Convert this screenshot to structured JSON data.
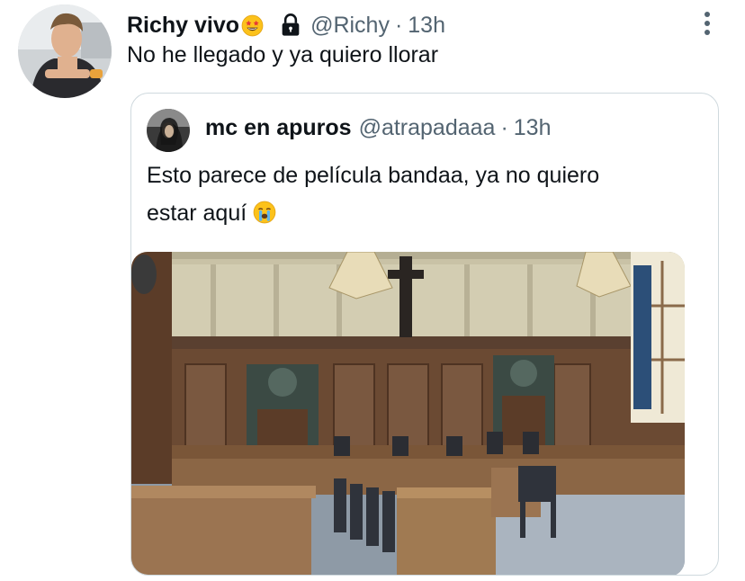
{
  "tweet": {
    "display_name": "Richy vivo",
    "handle": "@Richy",
    "separator": "·",
    "time": "13h",
    "text": "No he llegado y ya quiero llorar",
    "name_emoji": "star-struck-emoji",
    "protected_icon": "lock-icon"
  },
  "quoted_tweet": {
    "display_name": "mc en apuros",
    "handle": "@atrapadaaa",
    "separator": "·",
    "time": "13h",
    "text_line1": "Esto parece de película bandaa, ya no quiero",
    "text_line2": "estar aquí",
    "text_emoji": "loudly-crying-face-emoji",
    "media": "courtroom-photo"
  },
  "colors": {
    "primary_text": "#0f1419",
    "secondary_text": "#536471",
    "border": "#cfd9de"
  }
}
